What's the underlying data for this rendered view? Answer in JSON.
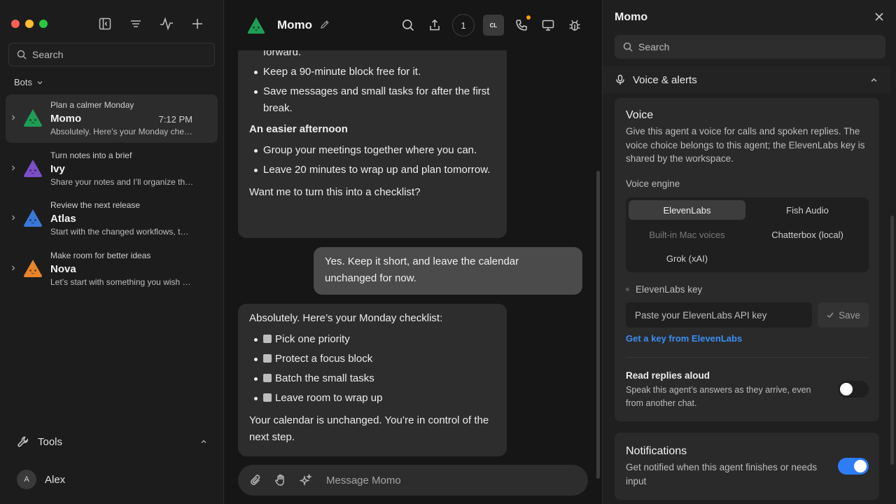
{
  "sidebar": {
    "search_placeholder": "Search",
    "bots_label": "Bots",
    "bots": [
      {
        "topic": "Plan a calmer Monday",
        "name": "Momo",
        "time": "7:12 PM",
        "preview": "Absolutely. Here’s your Monday che…",
        "color": "#1f9d55",
        "active": true
      },
      {
        "topic": "Turn notes into a brief",
        "name": "Ivy",
        "time": "",
        "preview": "Share your notes and I’ll organize th…",
        "color": "#7b4fc9",
        "active": false
      },
      {
        "topic": "Review the next release",
        "name": "Atlas",
        "time": "",
        "preview": "Start with the changed workflows, t…",
        "color": "#3a78d8",
        "active": false
      },
      {
        "topic": "Make room for better ideas",
        "name": "Nova",
        "time": "",
        "preview": "Let’s start with something you wish …",
        "color": "#e8852b",
        "active": false
      }
    ],
    "tools_label": "Tools",
    "user_initial": "A",
    "user_name": "Alex"
  },
  "chat": {
    "title": "Momo",
    "count_badge": "1",
    "cl_badge": "CL",
    "msg1": {
      "intro_tail": "forward.",
      "bullets_a": [
        "Keep a 90-minute block free for it.",
        "Save messages and small tasks for after the first break."
      ],
      "heading": "An easier afternoon",
      "bullets_b": [
        "Group your meetings together where you can.",
        "Leave 20 minutes to wrap up and plan tomorrow."
      ],
      "closing": "Want me to turn this into a checklist?"
    },
    "msg2": "Yes. Keep it short, and leave the calendar unchanged for now.",
    "msg3": {
      "intro": "Absolutely. Here’s your Monday checklist:",
      "checklist": [
        "Pick one priority",
        "Protect a focus block",
        "Batch the small tasks",
        "Leave room to wrap up"
      ],
      "closing": "Your calendar is unchanged. You’re in control of the next step."
    },
    "composer_placeholder": "Message Momo"
  },
  "panel": {
    "title": "Momo",
    "search_placeholder": "Search",
    "section_title": "Voice & alerts",
    "voice": {
      "title": "Voice",
      "description": "Give this agent a voice for calls and spoken replies. The voice choice belongs to this agent; the ElevenLabs key is shared by the workspace.",
      "engine_label": "Voice engine",
      "engines": [
        "ElevenLabs",
        "Fish Audio",
        "Built-in Mac voices",
        "Chatterbox (local)",
        "Grok (xAI)"
      ],
      "selected_engine": "ElevenLabs",
      "key_label": "ElevenLabs key",
      "key_placeholder": "Paste your ElevenLabs API key",
      "save_label": "Save",
      "key_link": "Get a key from ElevenLabs",
      "read_title": "Read replies aloud",
      "read_desc": "Speak this agent’s answers as they arrive, even from another chat.",
      "read_enabled": false
    },
    "notifications": {
      "title": "Notifications",
      "description": "Get notified when this agent finishes or needs input",
      "enabled": true
    }
  },
  "colors": {
    "accent": "#2e7cf6",
    "link": "#3b8ff5",
    "notify_dot": "#ff9f0a"
  }
}
